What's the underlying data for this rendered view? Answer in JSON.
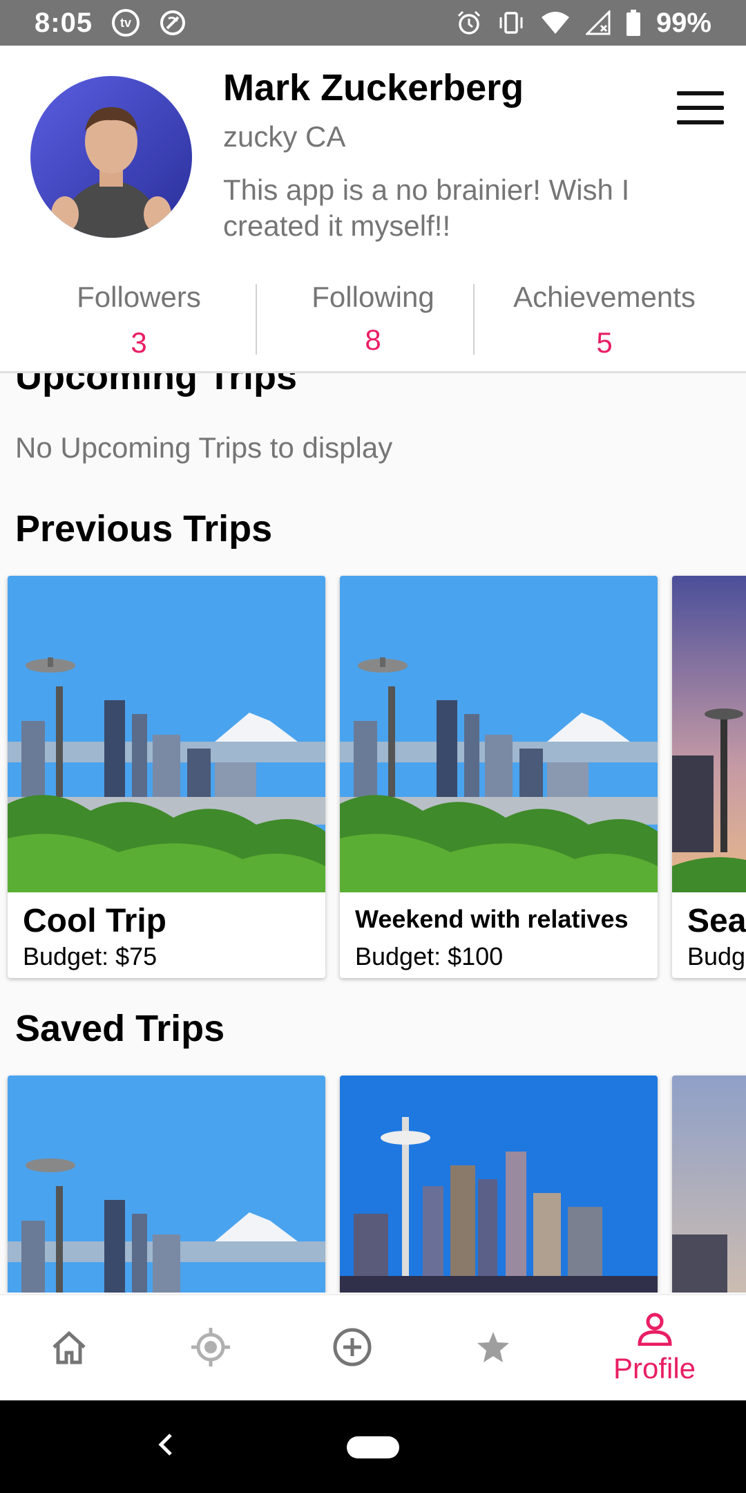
{
  "status_bar": {
    "time": "8:05",
    "badge_text": "tv",
    "battery": "99%"
  },
  "profile": {
    "name": "Mark Zuckerberg",
    "handle": "zucky  CA",
    "bio": "This app is a no brainier! Wish I created it myself!!"
  },
  "stats": [
    {
      "label": "Followers",
      "value": "3"
    },
    {
      "label": "Following",
      "value": "8"
    },
    {
      "label": "Achievements",
      "value": "5"
    }
  ],
  "sections": {
    "upcoming_title": "Upcoming Trips",
    "upcoming_empty": "No Upcoming Trips to display",
    "previous_title": "Previous Trips",
    "saved_title": "Saved Trips"
  },
  "previous_trips": [
    {
      "title": "Cool Trip",
      "budget": "Budget: $75"
    },
    {
      "title": "Weekend with relatives",
      "budget": "Budget: $100"
    },
    {
      "title": "Sea",
      "budget": "Budg"
    }
  ],
  "bottom_nav": {
    "items": [
      "home-icon",
      "location-icon",
      "add-icon",
      "star-icon",
      "profile-icon"
    ],
    "active_label": "Profile"
  },
  "colors": {
    "accent": "#e91e63",
    "status_bar": "#757575",
    "text_secondary": "#757575"
  }
}
